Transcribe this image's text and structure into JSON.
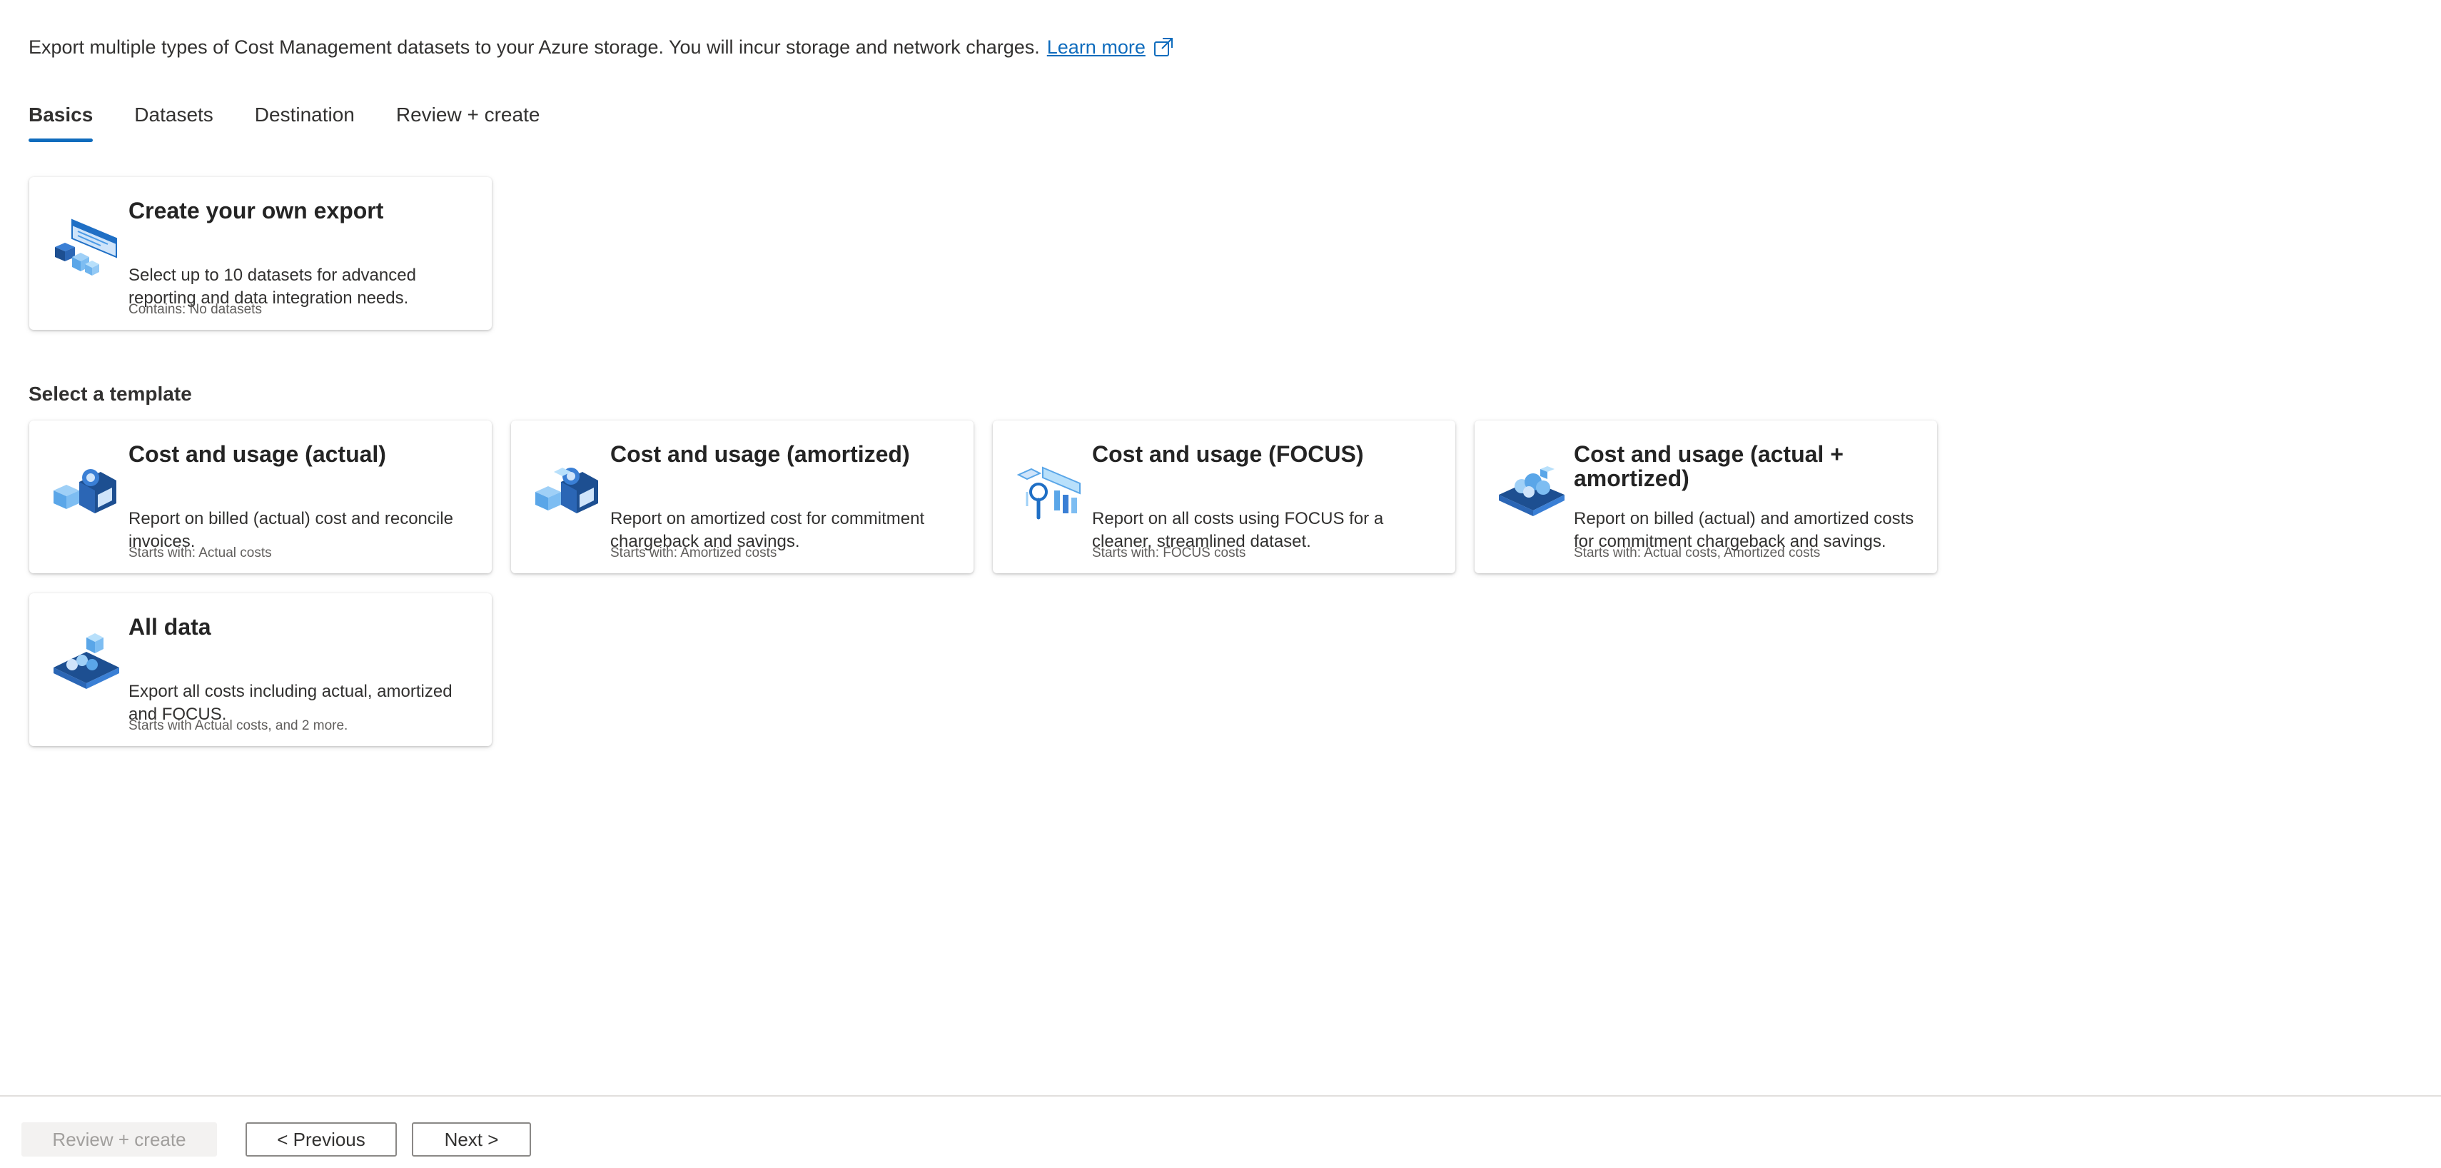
{
  "intro": {
    "text": "Export multiple types of Cost Management datasets to your Azure storage. You will incur storage and network charges.",
    "link": "Learn more",
    "link_icon": "external-link-icon"
  },
  "tabs": [
    {
      "label": "Basics",
      "active": true
    },
    {
      "label": "Datasets",
      "active": false
    },
    {
      "label": "Destination",
      "active": false
    },
    {
      "label": "Review + create",
      "active": false
    }
  ],
  "custom_export": {
    "title": "Create your own export",
    "description": "Select up to 10 datasets for advanced reporting and data integration needs.",
    "meta": "Contains: No datasets",
    "icon": "custom-export-illustration-icon"
  },
  "templates_heading": "Select a template",
  "templates": [
    {
      "title": "Cost and usage (actual)",
      "description": "Report on billed (actual) cost and reconcile invoices.",
      "meta": "Starts with: Actual costs",
      "icon": "actual-cost-illustration-icon"
    },
    {
      "title": "Cost and usage (amortized)",
      "description": "Report on amortized cost for commitment chargeback and savings.",
      "meta": "Starts with: Amortized costs",
      "icon": "amortized-cost-illustration-icon"
    },
    {
      "title": "Cost and usage (FOCUS)",
      "description": "Report on all costs using FOCUS for a cleaner, streamlined dataset.",
      "meta": "Starts with: FOCUS costs",
      "icon": "focus-cost-illustration-icon"
    },
    {
      "title": "Cost and usage (actual + amortized)",
      "description": "Report on billed (actual) and amortized costs for commitment chargeback and savings.",
      "meta": "Starts with: Actual costs, Amortized costs",
      "icon": "actual-amortized-illustration-icon"
    },
    {
      "title": "All data",
      "description": "Export all costs including actual, amortized and FOCUS.",
      "meta": "Starts with Actual costs, and 2 more.",
      "icon": "all-data-illustration-icon"
    }
  ],
  "footer": {
    "review_create": "Review + create",
    "previous": "< Previous",
    "next": "Next >"
  },
  "colors": {
    "accent": "#0f6cbd",
    "text": "#323130",
    "disabled_bg": "#f3f2f1"
  }
}
